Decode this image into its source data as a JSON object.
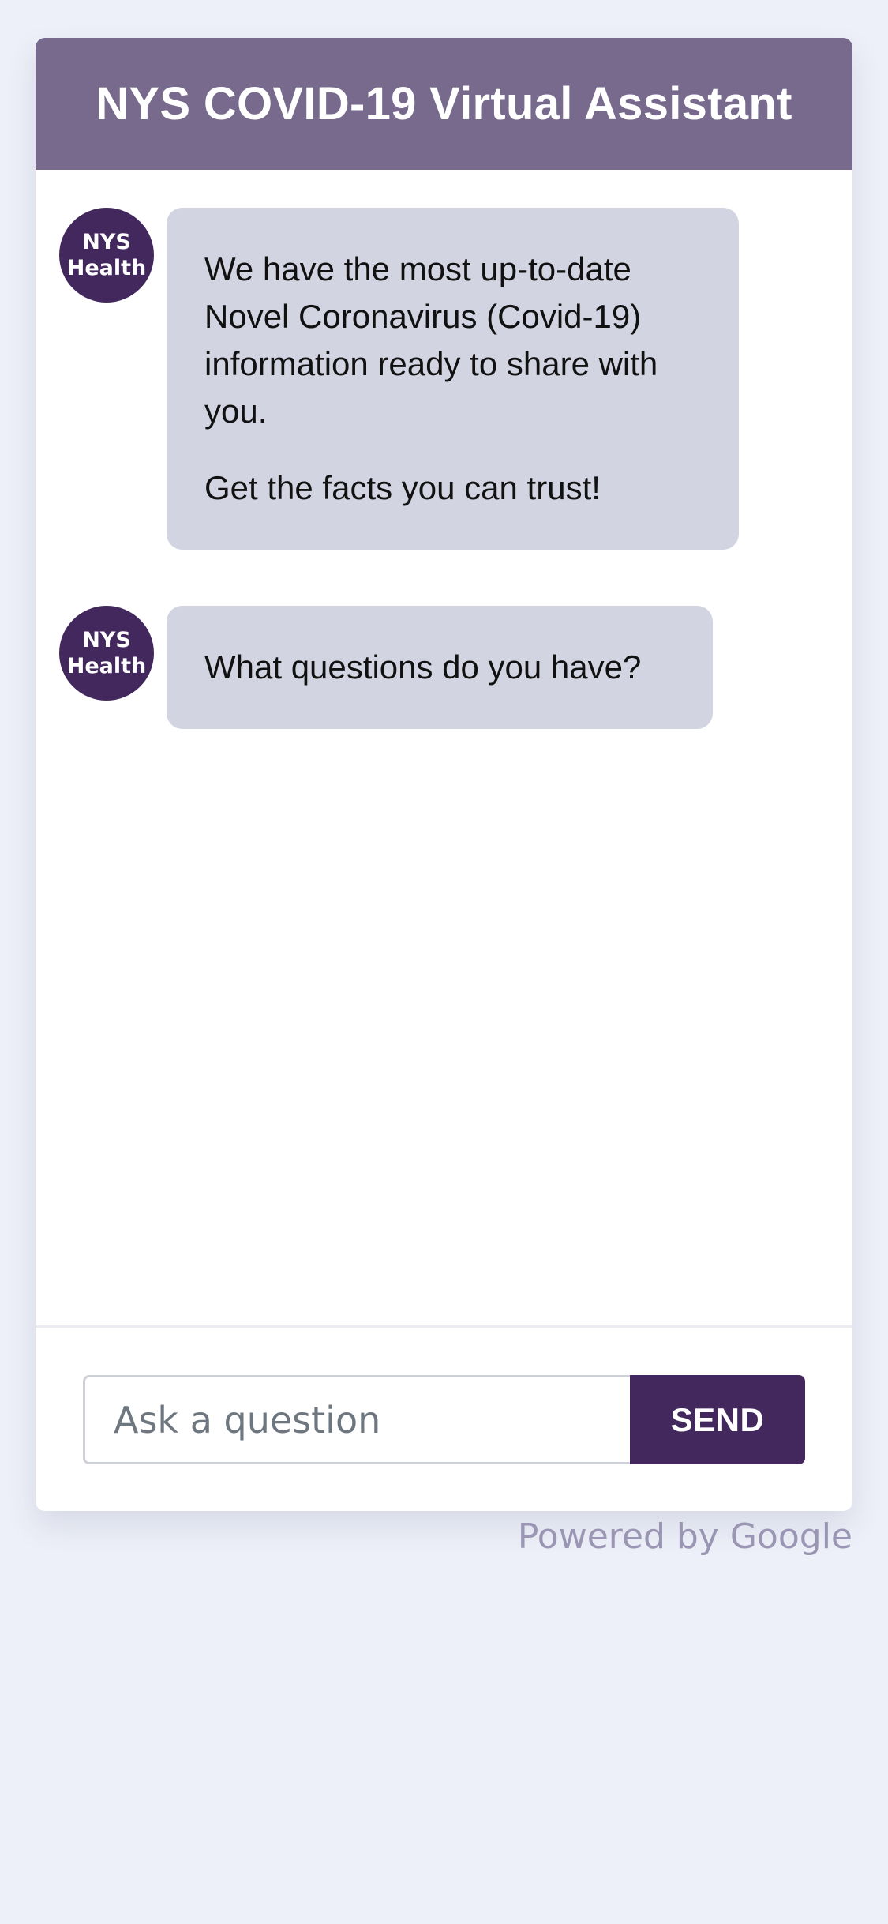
{
  "header": {
    "title": "NYS COVID-19 Virtual Assistant"
  },
  "avatar": {
    "line1": "NYS",
    "line2": "Health"
  },
  "messages": [
    {
      "paragraphs": [
        "We have the most up-to-date Novel Coronavirus (Covid-19) information ready to share with you.",
        "Get the facts you can trust!"
      ]
    },
    {
      "paragraphs": [
        "What questions do you have?"
      ]
    }
  ],
  "input": {
    "placeholder": "Ask a question",
    "value": ""
  },
  "send_label": "SEND",
  "footer": {
    "powered_by": "Powered by Google"
  },
  "colors": {
    "header_bg": "#776a8d",
    "brand_purple": "#43285e",
    "bubble_bg": "#d3d4e2",
    "page_bg": "#edf0f8"
  },
  "icons": {
    "avatar": "nys-health-logo-icon"
  }
}
